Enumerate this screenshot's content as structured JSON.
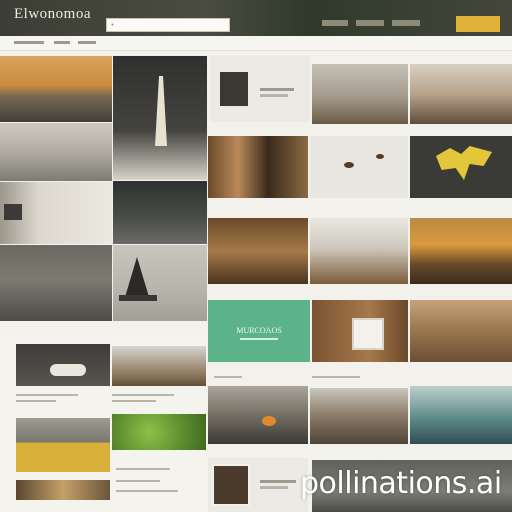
{
  "header": {
    "logo": "Elwonomoa",
    "logo_sub": "",
    "search_placeholder": "",
    "links": [],
    "cta_label": ""
  },
  "subnav": {
    "items": []
  },
  "sections": [
    {
      "caption": ""
    },
    {
      "caption": ""
    }
  ],
  "green_tile_label": "MURCOAOS",
  "watermark": "pollinations.ai"
}
